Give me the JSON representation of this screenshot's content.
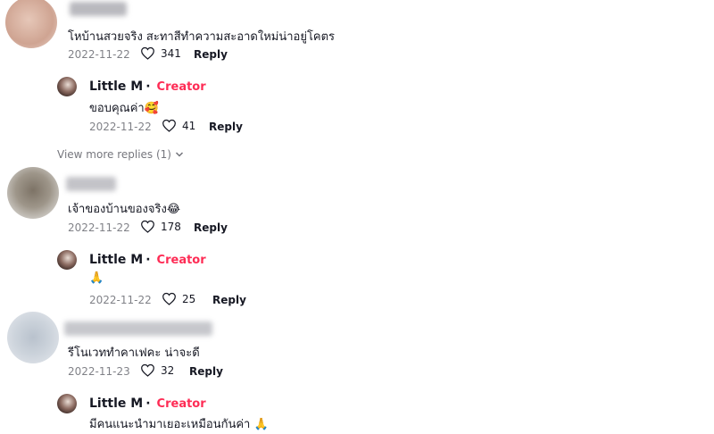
{
  "comments": [
    {
      "text": "โหบ้านสวยจริง สะทาสีทำความสะอาดใหม่น่าอยู่โคตร",
      "date": "2022-11-22",
      "likes": "341",
      "reply_label": "Reply",
      "reply": {
        "author": "Little M",
        "separator": "·",
        "badge": "Creator",
        "text": "ขอบคุณค่า🥰",
        "date": "2022-11-22",
        "likes": "41",
        "reply_label": "Reply"
      },
      "view_more": "View more replies (1)"
    },
    {
      "text": "เจ้าของบ้านของจริง😂",
      "date": "2022-11-22",
      "likes": "178",
      "reply_label": "Reply",
      "reply": {
        "author": "Little M",
        "separator": "·",
        "badge": "Creator",
        "text": "🙏",
        "date": "2022-11-22",
        "likes": "25",
        "reply_label": "Reply"
      }
    },
    {
      "text": "รีโนเวททำคาเฟคะ น่าจะดี",
      "date": "2022-11-23",
      "likes": "32",
      "reply_label": "Reply",
      "reply": {
        "author": "Little M",
        "separator": "·",
        "badge": "Creator",
        "text": "มีคนแนะนำมาเยอะเหมือนกันค่า 🙏"
      }
    }
  ],
  "colors": {
    "creator": "#fe2c55",
    "meta": "#8a8b91"
  }
}
